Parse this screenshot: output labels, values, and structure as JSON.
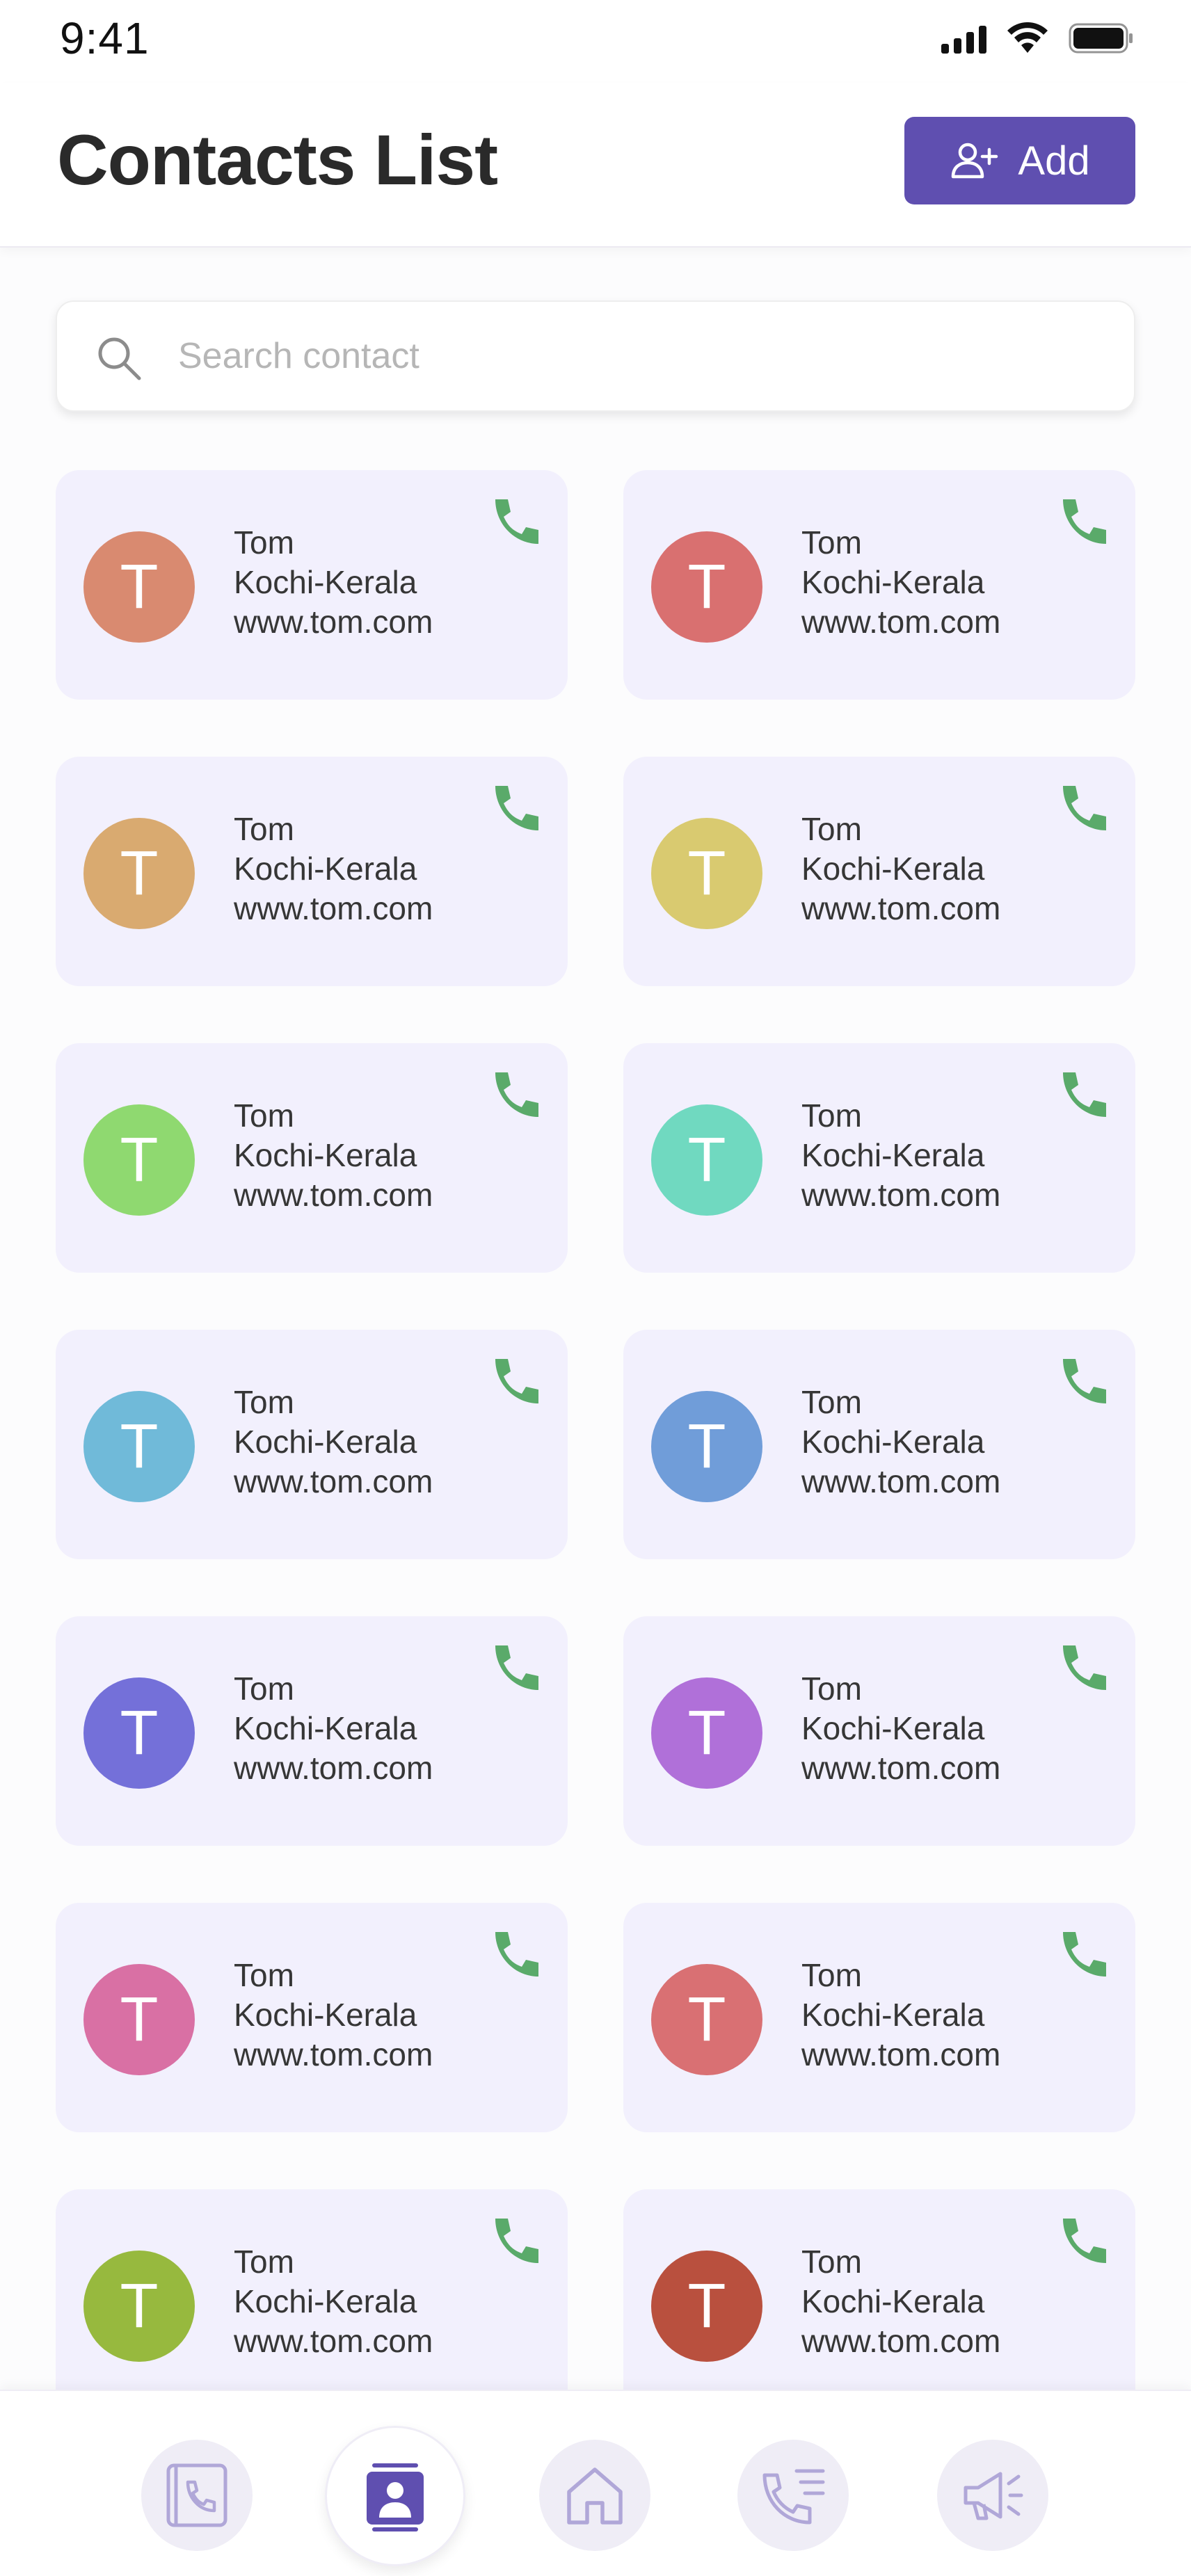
{
  "status_bar": {
    "time": "9:41"
  },
  "header": {
    "title": "Contacts List",
    "add_label": "Add"
  },
  "search": {
    "placeholder": "Search contact",
    "value": ""
  },
  "contacts": [
    {
      "initial": "T",
      "name": "Tom",
      "location": "Kochi-Kerala",
      "website": "www.tom.com",
      "color": "#d98a70"
    },
    {
      "initial": "T",
      "name": "Tom",
      "location": "Kochi-Kerala",
      "website": "www.tom.com",
      "color": "#d97070"
    },
    {
      "initial": "T",
      "name": "Tom",
      "location": "Kochi-Kerala",
      "website": "www.tom.com",
      "color": "#d9aa70"
    },
    {
      "initial": "T",
      "name": "Tom",
      "location": "Kochi-Kerala",
      "website": "www.tom.com",
      "color": "#d9ca70"
    },
    {
      "initial": "T",
      "name": "Tom",
      "location": "Kochi-Kerala",
      "website": "www.tom.com",
      "color": "#8fd970"
    },
    {
      "initial": "T",
      "name": "Tom",
      "location": "Kochi-Kerala",
      "website": "www.tom.com",
      "color": "#70d9c0"
    },
    {
      "initial": "T",
      "name": "Tom",
      "location": "Kochi-Kerala",
      "website": "www.tom.com",
      "color": "#70bad9"
    },
    {
      "initial": "T",
      "name": "Tom",
      "location": "Kochi-Kerala",
      "website": "www.tom.com",
      "color": "#709dd9"
    },
    {
      "initial": "T",
      "name": "Tom",
      "location": "Kochi-Kerala",
      "website": "www.tom.com",
      "color": "#7470d9"
    },
    {
      "initial": "T",
      "name": "Tom",
      "location": "Kochi-Kerala",
      "website": "www.tom.com",
      "color": "#b070d9"
    },
    {
      "initial": "T",
      "name": "Tom",
      "location": "Kochi-Kerala",
      "website": "www.tom.com",
      "color": "#d970a4"
    },
    {
      "initial": "T",
      "name": "Tom",
      "location": "Kochi-Kerala",
      "website": "www.tom.com",
      "color": "#d97073"
    },
    {
      "initial": "T",
      "name": "Tom",
      "location": "Kochi-Kerala",
      "website": "www.tom.com",
      "color": "#97b93e"
    },
    {
      "initial": "T",
      "name": "Tom",
      "location": "Kochi-Kerala",
      "website": "www.tom.com",
      "color": "#b9503e"
    }
  ],
  "nav": {
    "items": [
      {
        "icon": "phonebook-icon",
        "active": false
      },
      {
        "icon": "contact-card-icon",
        "active": true
      },
      {
        "icon": "home-icon",
        "active": false
      },
      {
        "icon": "call-log-icon",
        "active": false
      },
      {
        "icon": "megaphone-icon",
        "active": false
      }
    ]
  },
  "colors": {
    "accent": "#5f4fb0",
    "card_bg": "#f2f0fd",
    "call_icon": "#5aaa6a",
    "nav_icon": "#b0a7d8"
  }
}
